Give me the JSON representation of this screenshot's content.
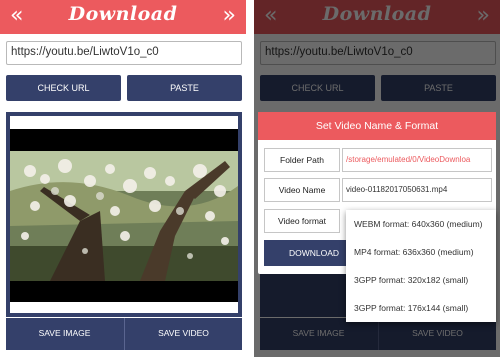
{
  "app": {
    "title": "Download",
    "back_icon": "«",
    "forward_icon": "»"
  },
  "url_input": {
    "value": "https://youtu.be/LiwtoV1o_c0"
  },
  "buttons": {
    "check_url": "CHECK URL",
    "paste": "PASTE",
    "save_image": "SAVE IMAGE",
    "save_video": "SAVE VIDEO"
  },
  "dialog": {
    "title": "Set Video Name & Format",
    "folder_path_label": "Folder Path",
    "folder_path_value": "/storage/emulated/0/VideoDownloa",
    "video_name_label": "Video Name",
    "video_name_value": "video-01182017050631.mp4",
    "video_format_label": "Video format",
    "download_button": "DOWNLOAD"
  },
  "format_options": [
    "WEBM format: 640x360 (medium)",
    "MP4 format: 636x360 (medium)",
    "3GPP format: 320x182 (small)",
    "3GPP format: 176x144 (small)"
  ],
  "colors": {
    "header": "#ec5a5e",
    "button": "#34406a",
    "accent_text": "#ec5a5e"
  }
}
